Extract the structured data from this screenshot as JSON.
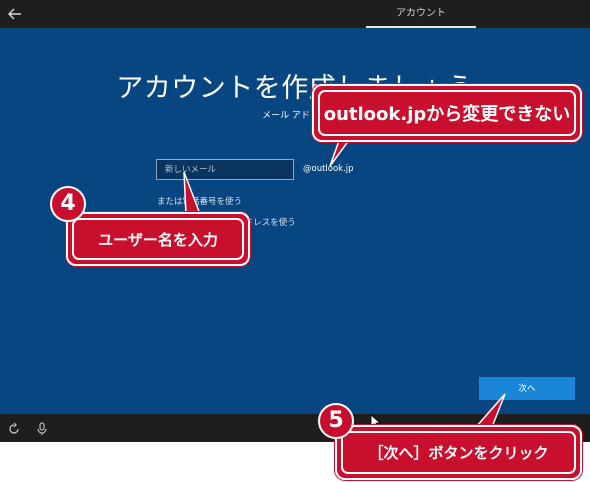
{
  "topbar": {
    "tab": "アカウント"
  },
  "main": {
    "title": "アカウントを作成しましょう",
    "subtitle": "メール アドレス",
    "email_placeholder": "新しいメール",
    "domain": "@outlook.jp",
    "link_phone": "または電話番号を使う",
    "link_existing": "または既存のメール アドレスを使う",
    "next_label": "次へ"
  },
  "callouts": {
    "c1_text": "outlook.jpから変更できない",
    "c2_text": "ユーザー名を入力",
    "c3_text": "［次へ］ボタンをクリック",
    "num4": "4",
    "num5": "5"
  },
  "colors": {
    "accent": "#1a86d8",
    "background": "#074681",
    "callout": "#c8102e"
  },
  "icons": [
    "back-arrow-icon",
    "ease-of-access-icon",
    "microphone-icon",
    "volume-icon"
  ]
}
